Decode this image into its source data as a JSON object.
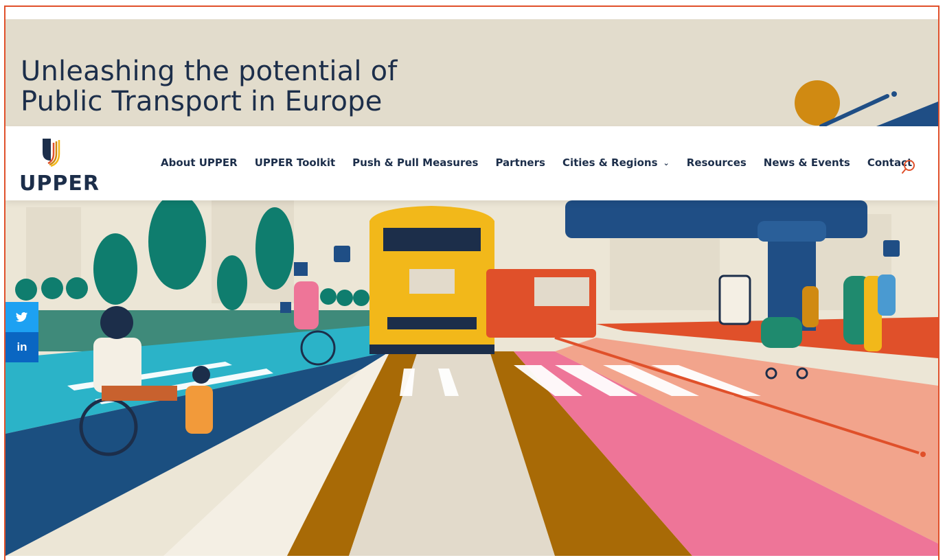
{
  "banner": {
    "title_line1": "Unleashing the potential of",
    "title_line2": "Public Transport in Europe"
  },
  "logo": {
    "text": "UPPER"
  },
  "nav": {
    "items": [
      "About UPPER",
      "UPPER Toolkit",
      "Push & Pull Measures",
      "Partners",
      "Cities & Regions",
      "Resources",
      "News & Events",
      "Contact"
    ]
  },
  "social": {
    "twitter_icon": "twitter-icon",
    "linkedin_label": "in"
  },
  "colors": {
    "accent": "#e0502a",
    "navy": "#1c2e4a",
    "banner_bg": "#e2dccc",
    "twitter": "#1da1f2",
    "linkedin": "#0a66c2"
  }
}
